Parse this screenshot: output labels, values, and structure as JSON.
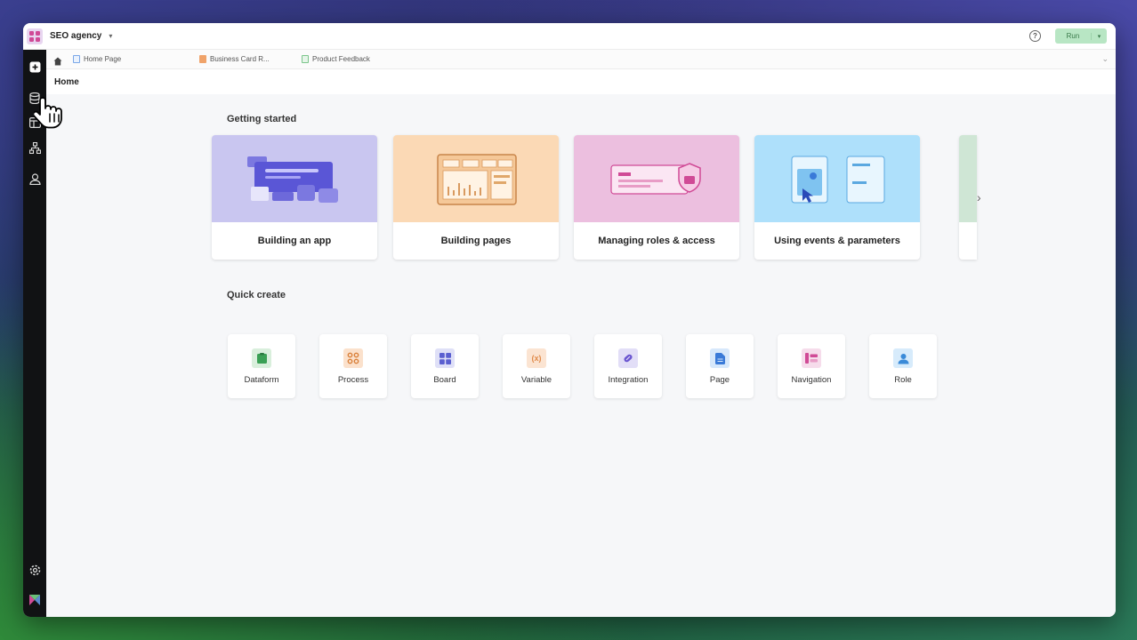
{
  "window": {
    "app_name": "SEO agency",
    "run_label": "Run"
  },
  "tabs": [
    {
      "label": "Home Page",
      "icon": "page-icon",
      "color": "#7aa7e8"
    },
    {
      "label": "Business Card R...",
      "icon": "board-icon",
      "color": "#f0a36a"
    },
    {
      "label": "Product Feedback",
      "icon": "dataform-icon",
      "color": "#7ac58a"
    }
  ],
  "page": {
    "title": "Home"
  },
  "getting_started": {
    "title": "Getting started",
    "cards": [
      {
        "label": "Building an app",
        "color": "#c9c6f0"
      },
      {
        "label": "Building pages",
        "color": "#fbd9b5"
      },
      {
        "label": "Managing roles & access",
        "color": "#ecbfdf"
      },
      {
        "label": "Using events & parameters",
        "color": "#aee0fb"
      }
    ]
  },
  "quick_create": {
    "title": "Quick create",
    "items": [
      {
        "label": "Dataform",
        "icon": "dataform-icon",
        "bg": "#d9efdc",
        "fg": "#3aa055"
      },
      {
        "label": "Process",
        "icon": "process-icon",
        "bg": "#fbe1cc",
        "fg": "#d9803a"
      },
      {
        "label": "Board",
        "icon": "board-icon",
        "bg": "#dfe0f7",
        "fg": "#5a5fd0"
      },
      {
        "label": "Variable",
        "icon": "variable-icon",
        "bg": "#fbe4d2",
        "fg": "#e08a4a",
        "glyph": "(x)"
      },
      {
        "label": "Integration",
        "icon": "integration-icon",
        "bg": "#e2def7",
        "fg": "#6a55d0"
      },
      {
        "label": "Page",
        "icon": "page-icon",
        "bg": "#d7e8fb",
        "fg": "#3a7ad8"
      },
      {
        "label": "Navigation",
        "icon": "navigation-icon",
        "bg": "#f6dceb",
        "fg": "#d04a96"
      },
      {
        "label": "Role",
        "icon": "role-icon",
        "bg": "#d7ebfb",
        "fg": "#3a8ad8"
      }
    ]
  }
}
